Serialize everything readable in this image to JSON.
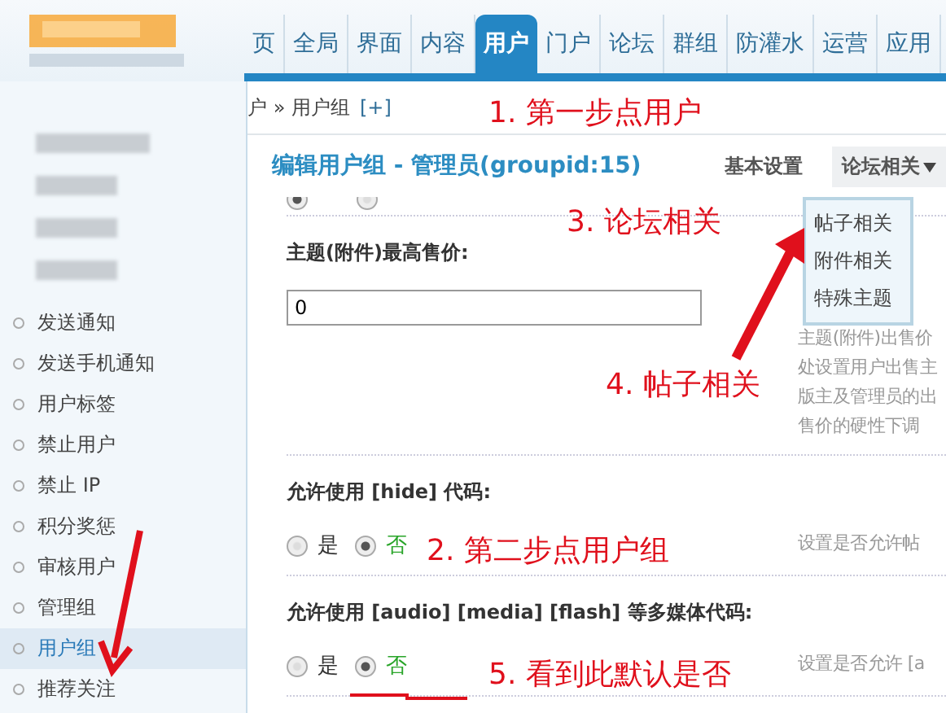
{
  "nav": {
    "tabs": [
      {
        "label": "页",
        "selected": false
      },
      {
        "label": "全局",
        "selected": false
      },
      {
        "label": "界面",
        "selected": false
      },
      {
        "label": "内容",
        "selected": false
      },
      {
        "label": "用户",
        "selected": true
      },
      {
        "label": "门户",
        "selected": false
      },
      {
        "label": "论坛",
        "selected": false
      },
      {
        "label": "群组",
        "selected": false
      },
      {
        "label": "防灌水",
        "selected": false
      },
      {
        "label": "运营",
        "selected": false
      },
      {
        "label": "应用",
        "selected": false
      }
    ]
  },
  "breadcrumb": {
    "path": "户 » 用户组",
    "add": "[+]"
  },
  "sidebar": {
    "items": [
      {
        "label": "发送通知",
        "selected": false
      },
      {
        "label": "发送手机通知",
        "selected": false
      },
      {
        "label": "用户标签",
        "selected": false
      },
      {
        "label": "禁止用户",
        "selected": false
      },
      {
        "label": "禁止 IP",
        "selected": false
      },
      {
        "label": "积分奖惩",
        "selected": false
      },
      {
        "label": "审核用户",
        "selected": false
      },
      {
        "label": "管理组",
        "selected": false
      },
      {
        "label": "用户组",
        "selected": true
      },
      {
        "label": "推荐关注",
        "selected": false
      }
    ]
  },
  "page": {
    "title": "编辑用户组 - 管理员(groupid:15)",
    "tabs": [
      {
        "label": "基本设置",
        "selected": false,
        "dropdown": false
      },
      {
        "label": "论坛相关",
        "selected": true,
        "dropdown": true
      }
    ],
    "menu": [
      "帖子相关",
      "附件相关",
      "特殊主题"
    ]
  },
  "form": [
    {
      "kind": "radio_cut",
      "options": [
        {
          "selected": true
        },
        {
          "selected": false
        }
      ]
    },
    {
      "kind": "text",
      "label": "主题(附件)最高售价:",
      "value": "0",
      "description": [
        "主题(附件)出售价",
        "处设置用户出售主",
        "版主及管理员的出",
        "售价的硬性下调"
      ]
    },
    {
      "kind": "radio",
      "label": "允许使用 [hide] 代码:",
      "options": [
        {
          "label": "是",
          "selected": false
        },
        {
          "label": "否",
          "selected": true
        }
      ],
      "description": [
        "设置是否允许帖"
      ]
    },
    {
      "kind": "radio",
      "label": "允许使用 [audio] [media] [flash] 等多媒体代码:",
      "options": [
        {
          "label": "是",
          "selected": false
        },
        {
          "label": "否",
          "selected": true
        }
      ],
      "description": [
        "设置是否允许 [a"
      ]
    }
  ],
  "annotations": [
    "1. 第一步点用户",
    "3. 论坛相关",
    "4. 帖子相关",
    "2. 第二步点用户组",
    "5. 看到此默认是否"
  ]
}
